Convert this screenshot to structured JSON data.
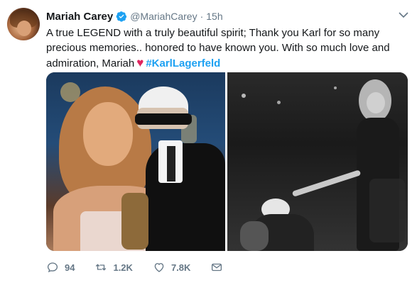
{
  "tweet": {
    "author_name": "Mariah Carey",
    "handle": "@MariahCarey",
    "separator": "·",
    "time": "15h",
    "text_main": "A true LEGEND with a truly beautiful spirit; Thank you Karl for so many precious memories.. honored to have known you. With so much love and admiration, Mariah",
    "heart": "♥",
    "hashtag": "#KarlLagerfeld"
  },
  "media": {
    "left_icon": "photo",
    "right_icon": "photo"
  },
  "actions": {
    "reply_count": "94",
    "retweet_count": "1.2K",
    "like_count": "7.8K"
  },
  "icons": [
    "verified-badge-icon",
    "chevron-down-icon",
    "reply-icon",
    "retweet-icon",
    "like-icon",
    "message-icon"
  ],
  "colors": {
    "link": "#1da1f2",
    "heart": "#e0245e",
    "muted": "#657786"
  }
}
